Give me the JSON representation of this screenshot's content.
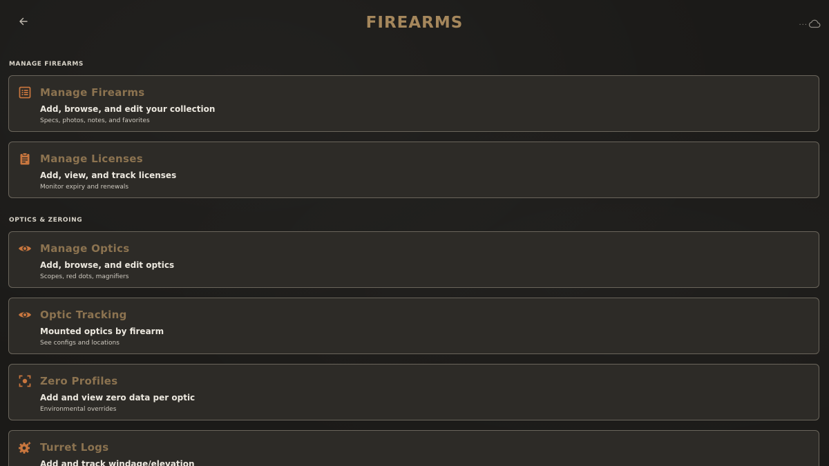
{
  "header": {
    "title": "FIREARMS",
    "back_icon": "back-arrow-icon",
    "sync_indicator": "...",
    "cloud_icon": "cloud-icon"
  },
  "colors": {
    "accent": "#c8763e",
    "title": "#a5875c",
    "card_title": "#8c7350",
    "card_bg": "#2d2b27",
    "card_border": "#6b665c"
  },
  "sections": [
    {
      "label": "MANAGE FIREARMS",
      "cards": [
        {
          "icon": "list-icon",
          "title": "Manage Firearms",
          "subtitle": "Add, browse, and edit your collection",
          "detail": "Specs, photos, notes, and favorites"
        },
        {
          "icon": "clipboard-icon",
          "title": "Manage Licenses",
          "subtitle": "Add, view, and track licenses",
          "detail": "Monitor expiry and renewals"
        }
      ]
    },
    {
      "label": "OPTICS & ZEROING",
      "cards": [
        {
          "icon": "eye-icon",
          "title": "Manage Optics",
          "subtitle": "Add, browse, and edit optics",
          "detail": "Scopes, red dots, magnifiers"
        },
        {
          "icon": "eye-icon",
          "title": "Optic Tracking",
          "subtitle": "Mounted optics by firearm",
          "detail": "See configs and locations"
        },
        {
          "icon": "crosshair-icon",
          "title": "Zero Profiles",
          "subtitle": "Add and view zero data per optic",
          "detail": "Environmental overrides"
        },
        {
          "icon": "gear-icon",
          "title": "Turret Logs",
          "subtitle": "Add and track windage/elevation",
          "detail": ""
        }
      ]
    }
  ]
}
